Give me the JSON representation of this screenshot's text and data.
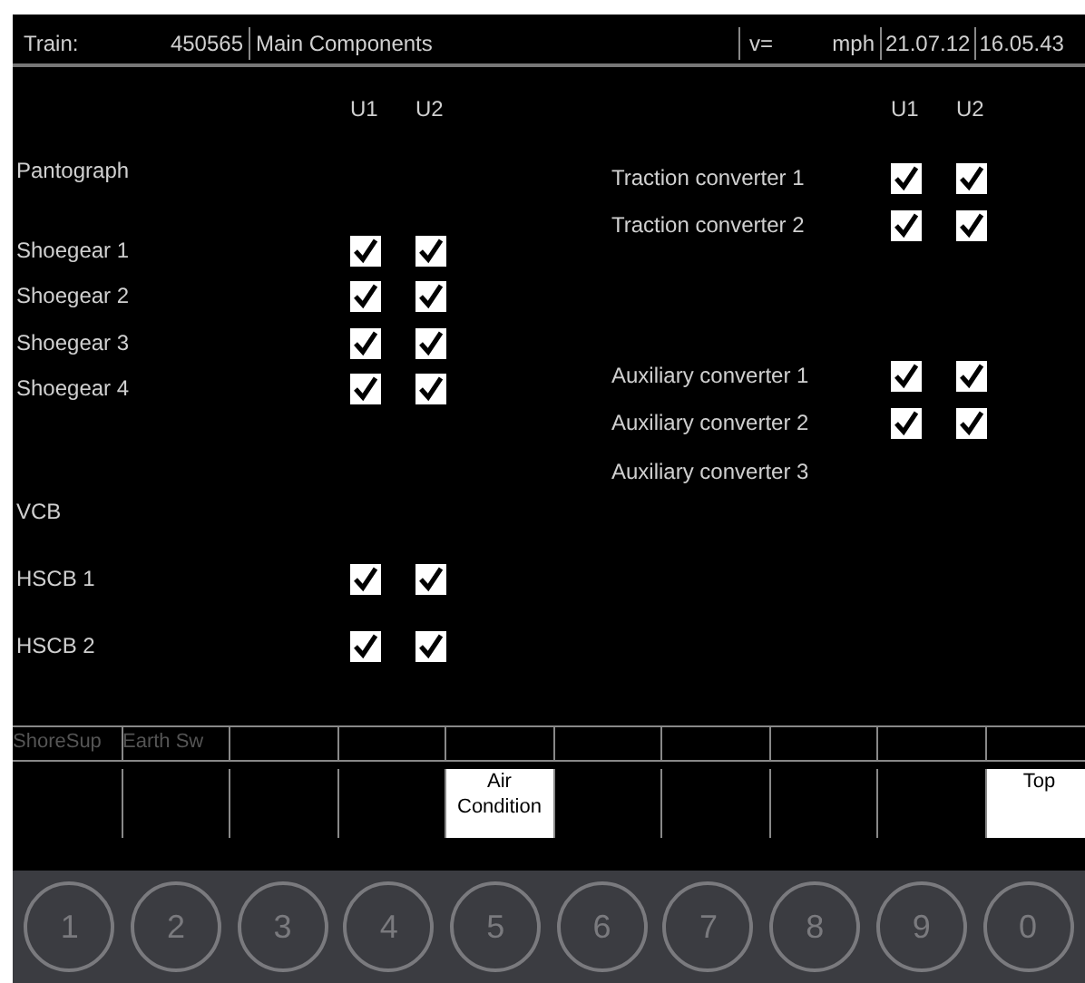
{
  "header": {
    "train_label": "Train:",
    "train_number": "450565",
    "title": "Main Components",
    "speed_label": "v=",
    "speed_unit": "mph",
    "date": "21.07.12",
    "time": "16.05.43"
  },
  "left": {
    "columns": [
      "U1",
      "U2"
    ],
    "rows": [
      {
        "label": "Pantograph"
      },
      {
        "label": "Shoegear 1",
        "u1": true,
        "u2": true
      },
      {
        "label": "Shoegear 2",
        "u1": true,
        "u2": true
      },
      {
        "label": "Shoegear 3",
        "u1": true,
        "u2": true
      },
      {
        "label": "Shoegear 4",
        "u1": true,
        "u2": true
      },
      {
        "label": "VCB"
      },
      {
        "label": "HSCB 1",
        "u1": true,
        "u2": true
      },
      {
        "label": "HSCB 2",
        "u1": true,
        "u2": true
      }
    ]
  },
  "right": {
    "columns": [
      "U1",
      "U2"
    ],
    "rows": [
      {
        "label": "Traction converter 1",
        "u1": true,
        "u2": true
      },
      {
        "label": "Traction converter 2",
        "u1": true,
        "u2": true
      },
      {
        "label": "Auxiliary converter 1",
        "u1": true,
        "u2": true
      },
      {
        "label": "Auxiliary converter 2",
        "u1": true,
        "u2": true
      },
      {
        "label": "Auxiliary converter 3"
      }
    ]
  },
  "status_keys": [
    {
      "label": "ShoreSup"
    },
    {
      "label": "Earth Sw"
    }
  ],
  "soft_keys": [
    {
      "label": "Air Condition"
    },
    {
      "label": "Top"
    }
  ],
  "keypad": [
    "1",
    "2",
    "3",
    "4",
    "5",
    "6",
    "7",
    "8",
    "9",
    "0"
  ]
}
